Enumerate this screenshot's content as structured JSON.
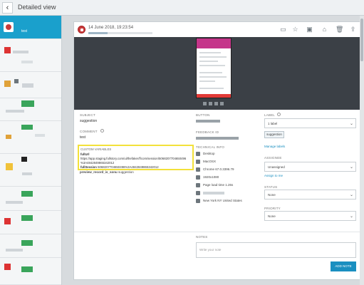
{
  "topbar": {
    "title": "Detailed view",
    "back_icon": "chevron-left-icon"
  },
  "sidebar": {
    "active_label": "test"
  },
  "record": {
    "timestamp": "14 June 2018, 19:23:54",
    "actions": [
      "comment-icon",
      "star-icon",
      "image-icon",
      "share-icon",
      "trash-icon",
      "export-icon"
    ]
  },
  "details": {
    "subject_label": "SUBJECT",
    "subject_value": "suggestion",
    "comment_label": "COMMENT",
    "comment_value": "test",
    "custom_vars_label": "CUSTOM VARIABLES",
    "url_key": "fullUrl",
    "url_value_1": "https://app.staging.fullstory.com/ui/thefaker/f/com/session/5068207704650496",
    "url_value_2": "%3A4842849865342012",
    "session_key": "fullSession",
    "session_value": "5068207704650496%3A4842849865342012",
    "extra_key": "preview_record_is_sonu",
    "extra_value": "suggestion"
  },
  "middle": {
    "button_label": "BUTTON",
    "feedback_label": "FEEDBACK ID",
    "tech_label": "TECHNICAL INFO",
    "tech": [
      "Desktop",
      "MacOSX",
      "Chrome 67.0.3396.79",
      "1920x1080",
      "Page load time 1.26s",
      "",
      "New York NY United States"
    ]
  },
  "right": {
    "label_label": "LABEL",
    "label_select": "1 label",
    "label_chip": "suggestion",
    "manage_labels": "Manage labels",
    "assignee_label": "ASSIGNEE",
    "assignee_select": "Unassigned",
    "assign_me": "Assign to me",
    "status_label": "STATUS",
    "status_select": "None",
    "priority_label": "PRIORITY",
    "priority_select": "None"
  },
  "notes": {
    "label": "NOTES",
    "placeholder": "Write your note",
    "add_button": "ADD NOTE"
  },
  "colors": {
    "accent": "#1aa0cc",
    "highlight": "#f3e13a",
    "record_icon": "#c93a3a"
  }
}
